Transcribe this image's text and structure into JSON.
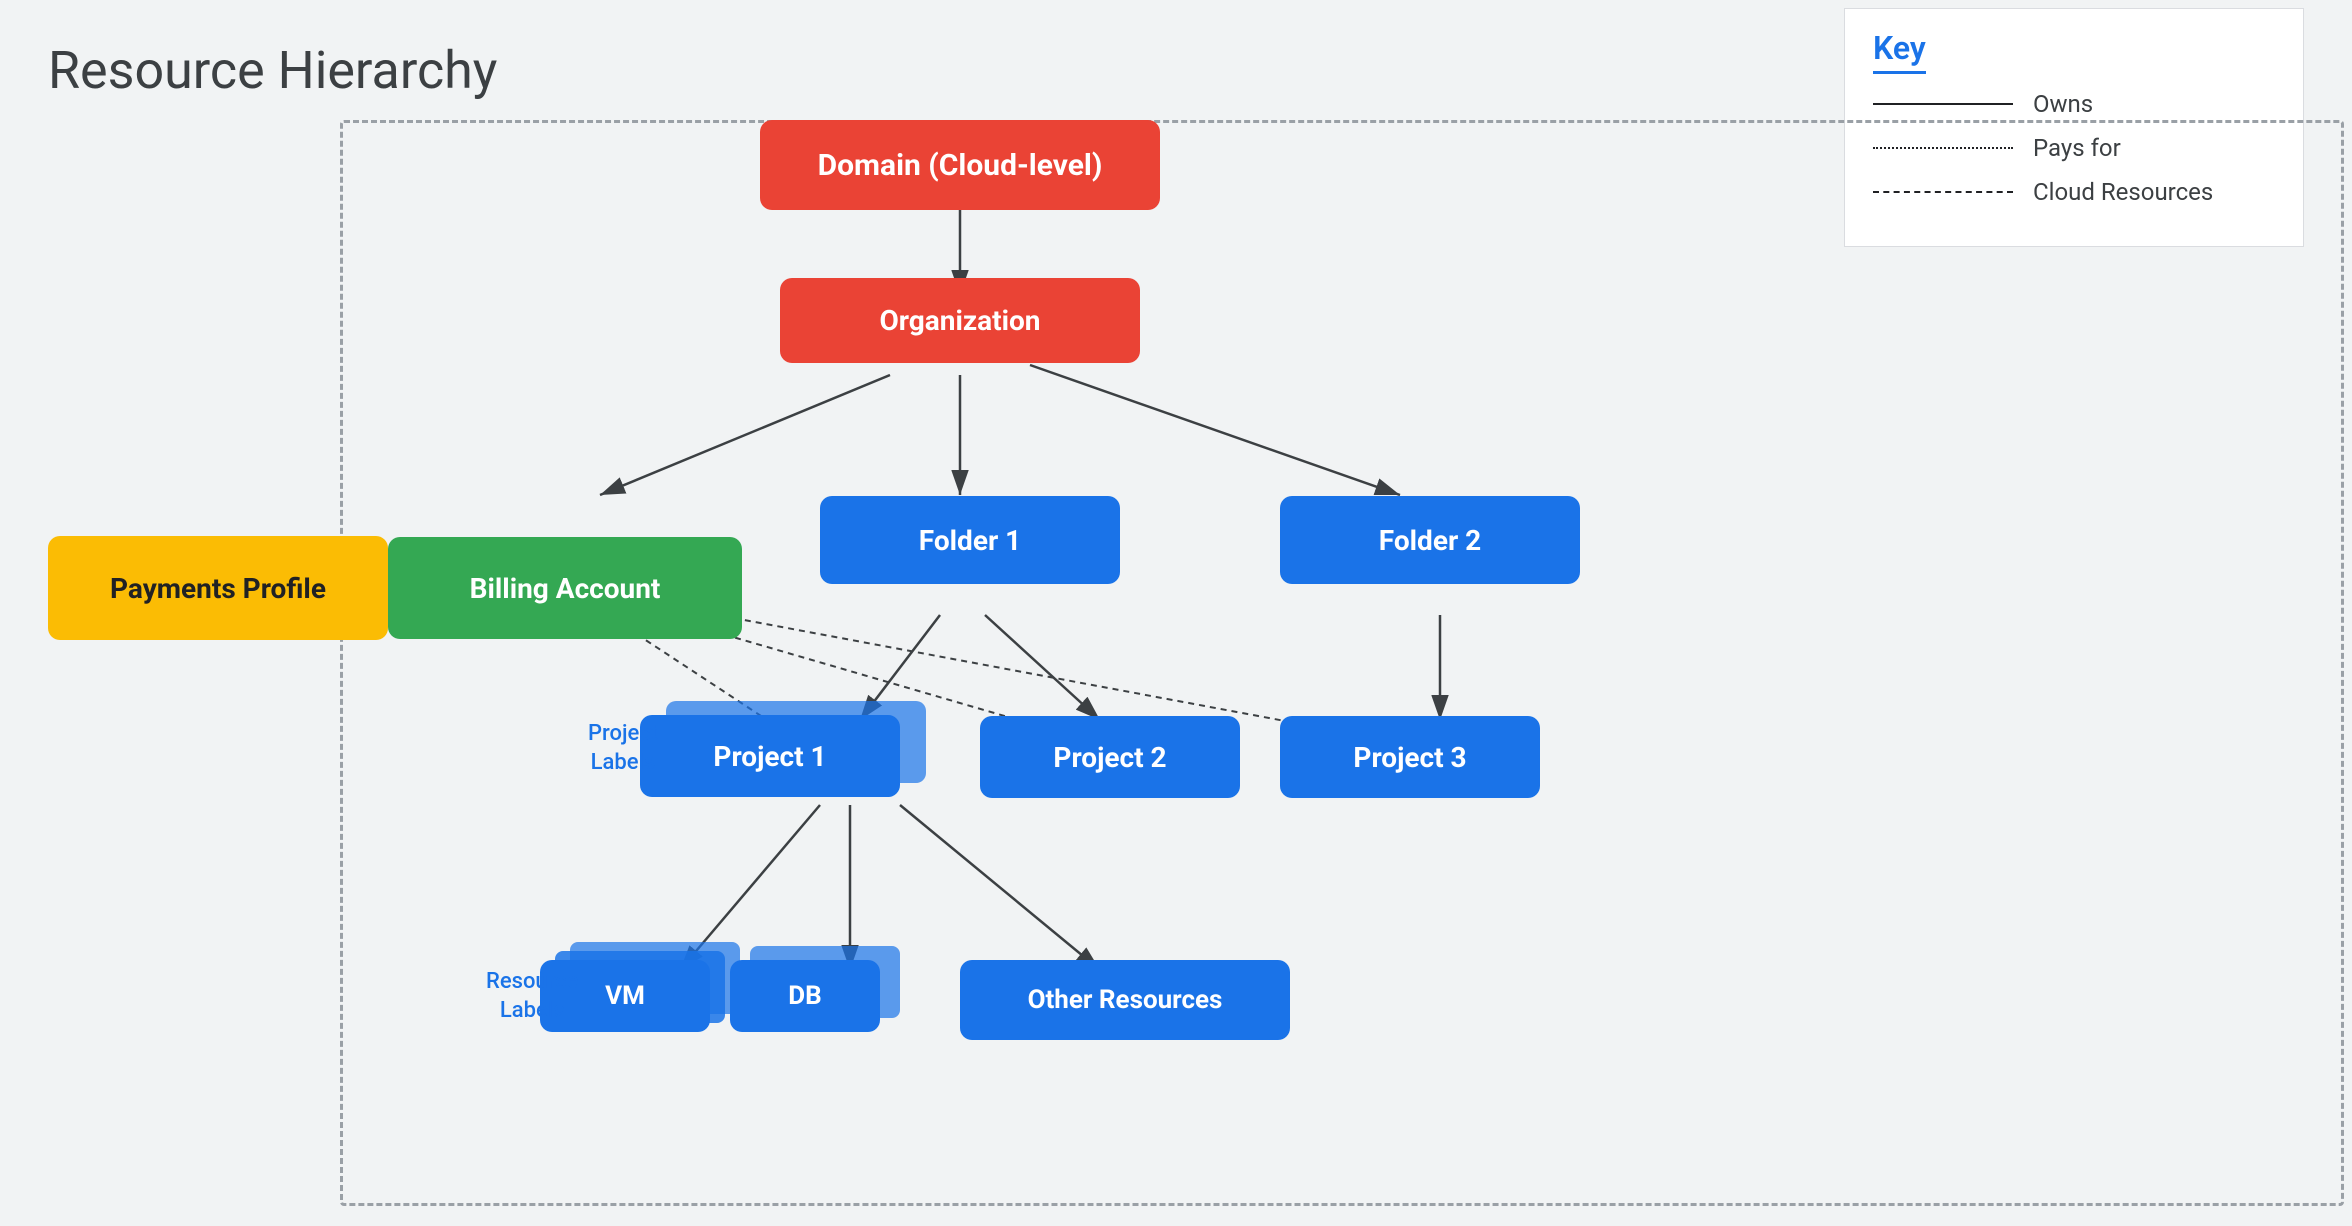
{
  "title": "Resource Hierarchy",
  "key": {
    "title": "Key",
    "items": [
      {
        "line": "solid",
        "label": "Owns"
      },
      {
        "line": "dotted",
        "label": "Pays for"
      },
      {
        "line": "dashed",
        "label": "Cloud Resources"
      }
    ]
  },
  "nodes": {
    "domain": "Domain (Cloud-level)",
    "organization": "Organization",
    "billingAccount": "Billing Account",
    "paymentsProfile": "Payments Profile",
    "folder1": "Folder 1",
    "folder2": "Folder 2",
    "project1": "Project 1",
    "project2": "Project 2",
    "project3": "Project 3",
    "vm": "VM",
    "db": "DB",
    "otherResources": "Other Resources"
  },
  "labels": {
    "projectLabels": "Project\nLabels",
    "resourceLabels": "Resource\nLabels"
  }
}
